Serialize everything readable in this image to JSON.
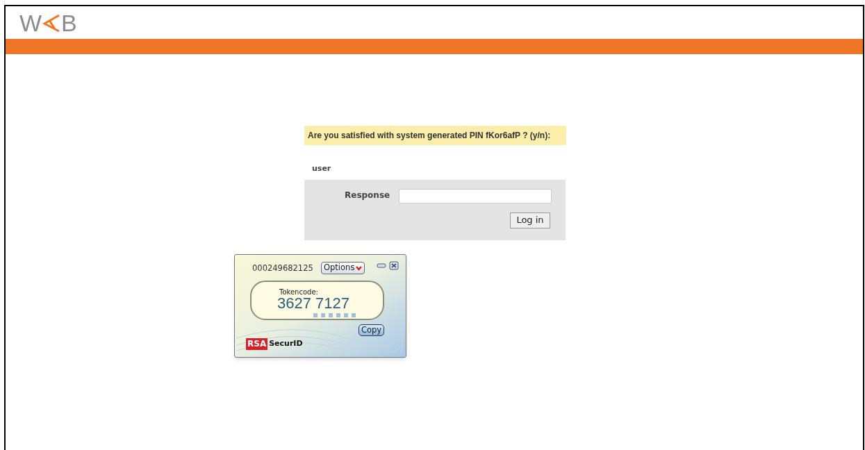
{
  "logo": {
    "letter_1": "W",
    "letter_2": "B"
  },
  "prompt": "Are you satisfied with system generated PIN fKor6afP ? (y/n):",
  "username": "user",
  "form": {
    "label": "Response",
    "button": "Log in"
  },
  "token": {
    "serial": "000249682125",
    "options": "Options",
    "label": "Tokencode:",
    "code": "3627 7127",
    "copy": "Copy",
    "brand_1": "RSA",
    "brand_2": "SecurID"
  }
}
